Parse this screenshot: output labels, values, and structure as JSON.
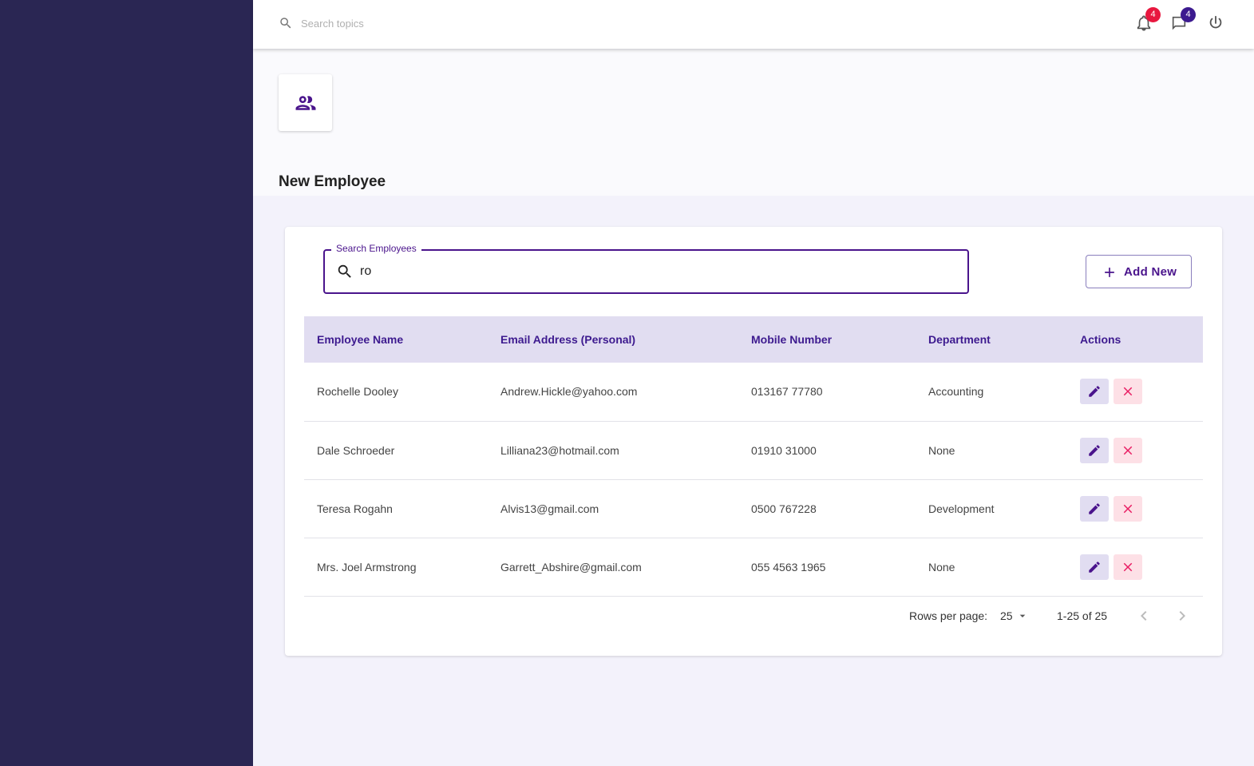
{
  "topbar": {
    "search_placeholder": "Search topics",
    "notifications_count": "4",
    "messages_count": "4"
  },
  "header": {
    "title": "New Employee"
  },
  "search": {
    "label": "Search Employees",
    "value": "ro"
  },
  "toolbar": {
    "add_label": "Add New"
  },
  "table": {
    "columns": [
      "Employee Name",
      "Email Address (Personal)",
      "Mobile Number",
      "Department",
      "Actions"
    ],
    "rows": [
      {
        "name": "Rochelle Dooley",
        "email": "Andrew.Hickle@yahoo.com",
        "mobile": "013167 77780",
        "department": "Accounting"
      },
      {
        "name": "Dale Schroeder",
        "email": "Lilliana23@hotmail.com",
        "mobile": "01910 31000",
        "department": "None"
      },
      {
        "name": "Teresa Rogahn",
        "email": "Alvis13@gmail.com",
        "mobile": "0500 767228",
        "department": "Development"
      },
      {
        "name": "Mrs. Joel Armstrong",
        "email": "Garrett_Abshire@gmail.com",
        "mobile": "055 4563 1965",
        "department": "None"
      }
    ]
  },
  "pagination": {
    "rows_per_page_label": "Rows per page:",
    "rows_per_page": "25",
    "range": "1-25 of 25"
  },
  "colors": {
    "sidebar": "#2a2653",
    "accent": "#4a148c",
    "danger": "#e91e63",
    "header_row": "#e1ddf1"
  }
}
